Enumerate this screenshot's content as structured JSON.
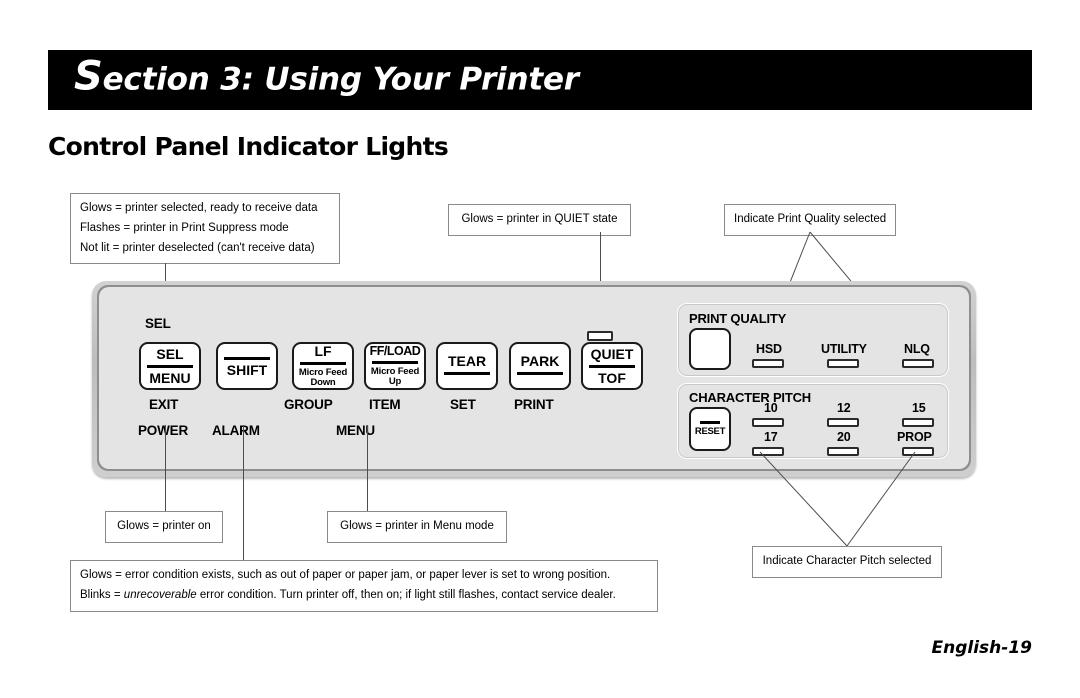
{
  "header": {
    "section_initial": "S",
    "section_rest": "ection 3:  Using Your Printer",
    "subtitle": "Control Panel Indicator Lights"
  },
  "footer": {
    "page_label": "English-19"
  },
  "callouts": {
    "sel_light": {
      "line1": "Glows = printer selected, ready to receive data",
      "line2": "Flashes = printer in Print Suppress mode",
      "line3": "Not lit = printer deselected (can't receive data)"
    },
    "quiet_light": {
      "line1": "Glows = printer in QUIET state"
    },
    "print_quality": {
      "line1": "Indicate Print Quality selected"
    },
    "character_pitch": {
      "line1": "Indicate Character Pitch selected"
    },
    "power_light": {
      "line1": "Glows = printer on"
    },
    "menu_light": {
      "line1": "Glows = printer in Menu mode"
    },
    "alarm_light": {
      "line1_a": "Glows = error condition exists, such as out of paper or paper jam, or paper lever is set to wrong position.",
      "line2_a": "Blinks = ",
      "line2_em": "unrecoverable",
      "line2_b": " error condition. Turn printer off, then on; if light still flashes, contact service dealer."
    }
  },
  "panel": {
    "indicator_labels": {
      "sel": "SEL"
    },
    "buttons": [
      {
        "top": "SEL",
        "bottom": "MENU",
        "under": "EXIT",
        "under2": "POWER"
      },
      {
        "top": "",
        "bottom": "SHIFT",
        "under": "",
        "under2": "ALARM"
      },
      {
        "top": "LF",
        "bottom_l1": "Micro Feed",
        "bottom_l2": "Down",
        "under": "GROUP",
        "under2": "MENU"
      },
      {
        "top": "FF/LOAD",
        "bottom_l1": "Micro Feed",
        "bottom_l2": "Up",
        "under": "ITEM",
        "under2": ""
      },
      {
        "top": "TEAR",
        "bottom": "",
        "under": "SET",
        "under2": ""
      },
      {
        "top": "PARK",
        "bottom": "",
        "under": "PRINT",
        "under2": ""
      },
      {
        "top": "QUIET",
        "bottom": "TOF",
        "under": "",
        "under2": ""
      }
    ],
    "print_quality": {
      "title": "PRINT QUALITY",
      "indicators": [
        "HSD",
        "UTILITY",
        "NLQ"
      ]
    },
    "character_pitch": {
      "title": "CHARACTER PITCH",
      "reset_label": "RESET",
      "indicators_row1": [
        "10",
        "12",
        "15"
      ],
      "indicators_row2": [
        "17",
        "20",
        "PROP"
      ]
    }
  },
  "colors": {
    "banner_bg": "#000000",
    "banner_text": "#ffffff",
    "panel_face": "#e4e4e4",
    "panel_bezel": "#8e8e8e",
    "button_face": "#ffffff",
    "ink": "#000000",
    "leader": "#4d4d4d"
  }
}
